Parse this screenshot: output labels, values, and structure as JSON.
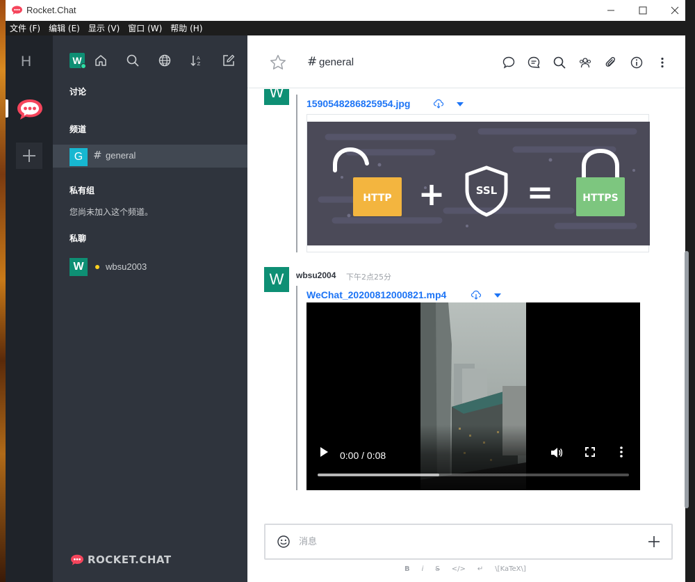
{
  "window": {
    "title": "Rocket.Chat"
  },
  "menu": [
    "文件 (F)",
    "编辑 (E)",
    "显示 (V)",
    "窗口 (W)",
    "帮助 (H)"
  ],
  "servers": {
    "letter": "H"
  },
  "sidebar": {
    "user_initial": "W",
    "sections": {
      "discussions": "讨论",
      "channels": "频道",
      "private_groups": "私有组",
      "direct_messages": "私聊"
    },
    "channel": {
      "initial": "G",
      "hash": "#",
      "name": "general"
    },
    "private_empty": "您尚未加入这个频道。",
    "dm": {
      "initial": "W",
      "name": "wbsu2003"
    },
    "logo_text": "ROCKET.CHAT"
  },
  "room": {
    "hash": "#",
    "title": "general"
  },
  "messages": [
    {
      "avatar_initial": "W",
      "file_name": "1590548286825954.jpg",
      "image_labels": {
        "left": "HTTP",
        "middle": "SSL",
        "right": "HTTPS",
        "plus": "+",
        "equals": "="
      }
    },
    {
      "avatar_initial": "W",
      "author": "wbsu2004",
      "time": "下午2点25分",
      "file_name": "WeChat_20200812000821.mp4",
      "video": {
        "time_display": "0:00 / 0:08",
        "buffered_fraction": 0.39
      }
    }
  ],
  "composer": {
    "placeholder": "消息",
    "format_buttons": [
      "B",
      "i",
      "S",
      "</>",
      "↵",
      "\\[KaTeX\\]"
    ]
  },
  "colors": {
    "sidebar_bg": "#2f343d",
    "rail_bg": "#1f2329",
    "link_blue": "#1d74f5",
    "avatar_green": "#0e8f74",
    "channel_avatar": "#17b7d1",
    "rocket_red": "#f5455c"
  }
}
